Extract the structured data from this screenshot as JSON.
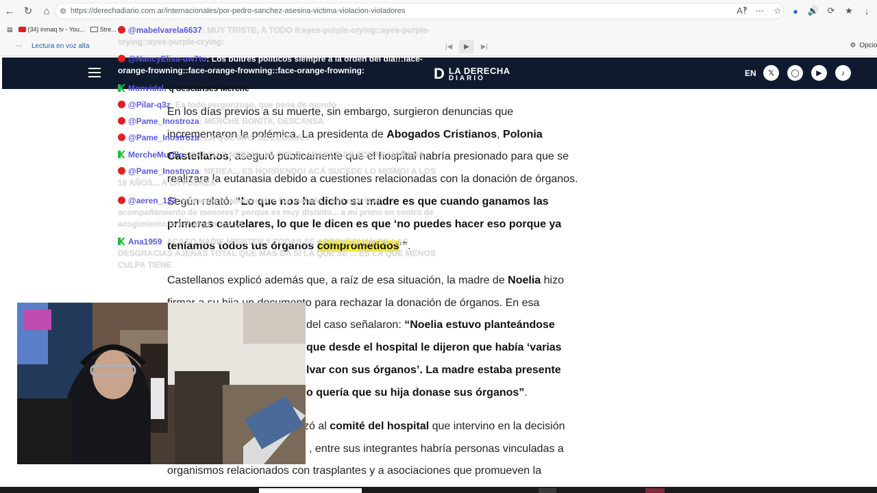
{
  "browser": {
    "url": "https://derechadiario.com.ar/internacionales/por-pedro-sanchez-asesina-victima-violacion-violadores",
    "bookmarks": [
      {
        "label": "(34) inmaq tv - You..."
      },
      {
        "label": "Stre..."
      }
    ],
    "read_aloud": {
      "label": "Lectura en voz alta",
      "options_label": "Opcion"
    }
  },
  "site": {
    "logo_line1": "LA DERECHA",
    "logo_line2": "DIARIO",
    "lang": "EN",
    "social": [
      "x-icon",
      "instagram-icon",
      "youtube-icon",
      "tiktok-icon"
    ]
  },
  "article": {
    "p1": {
      "t1": "En los días previos a su muerte, sin embargo, surgieron denuncias que incrementaron la polémica. La presidenta de ",
      "b1": "Abogados Cristianos",
      "t2": ", ",
      "b2": "Polonia Castellanos",
      "t3": ", aseguró públicamente que el hospital habría presionado para que se realizara la eutanasia debido a cuestiones relacionadas con la donación de órganos. Según relató: ",
      "b3": "“Lo que nos ha dicho su madre es que cuando ganamos las primeras cautelares, lo que le dicen es que ‘no puedes hacer eso porque ya teníamos todos tus órganos ",
      "hl": "comprometidos",
      "b4": "’”",
      "t4": "."
    },
    "p2": {
      "t1": "Castellanos explicó además que, a raíz de esa situación, la madre de ",
      "b1": "Noelia",
      "t2": " hizo firmar a su hija un documento para rechazar la donación de órganos. En esa",
      "t3": " del caso señalaron: ",
      "b2": "“Noelia estuvo planteándose",
      "b3": " que desde el hospital le dijeron que había ‘varias",
      "b4": "lvar con sus órganos’. La madre estaba presente",
      "b5": "o quería que su hija donase sus órganos”",
      "t4": "."
    },
    "p3": {
      "t1": "zó al ",
      "b1": "comité del hospital",
      "t2": " que intervino en la decisión",
      "t3": ", entre sus integrantes habría personas vinculadas a",
      "t4": "organismos relacionados con trasplantes y a asociaciones que promueven la"
    }
  },
  "chat": [
    {
      "user": "@mabelvarela6637",
      "msg": ": MUY TRISTE, A TODO ll:ayes-purple-crying::ayes-purple-crying::ayes-purple-crying:",
      "icon": "red"
    },
    {
      "user": "@NancyElisa-uw7to",
      "msg": ": Los buitres políticos siempre a la orden del día!!:face-orange-frowning::face-orange-frowning::face-orange-frowning:",
      "icon": "red"
    },
    {
      "user": "Monvidal",
      "msg": ": q descanses Merche",
      "icon": "green"
    },
    {
      "user": "@Pilar-q3z",
      "msg": ": Es todo vergonzoso, que pena de mundo",
      "icon": "red"
    },
    {
      "user": "@Pame_Inostroza",
      "msg": ": MERCHE BONITA, DESCANSA",
      "icon": "red"
    },
    {
      "user": "@Pame_Inostroza",
      "msg": ": LA QUE MAS SE ELOGIA...",
      "icon": "red"
    },
    {
      "user": "MercheMurillo",
      "msg": ": GRACIAS NOELIA, MI CIELO, ABARCE DE TODAS MAÑANA",
      "icon": "green"
    },
    {
      "user": "@Pame_Inostroza",
      "msg": ": NEREA... ES HORRENDO! ACÁ SUCEDE LO MISMO! A LOS 18 AÑOS... A LA FUERZA",
      "icon": "red"
    },
    {
      "user": "@aeren_123",
      "msg": ": y cuando la adolescente fue violada... ella quería el acompañamiento de menores? porque es muy distinto... a mi primo en centro de acogimiento lo echaron a los 18",
      "icon": "red"
    },
    {
      "user": "Ana1959",
      "msg": ": ACASO NADIE MIENTEN Y TODAS SE APROVECHAN DE LAS DESGRACIAS AJENAS TOTAL QUE MAS DA SI LA QUE SE ... ES LA QUE MENOS CULPA TIENE",
      "icon": "green"
    }
  ]
}
